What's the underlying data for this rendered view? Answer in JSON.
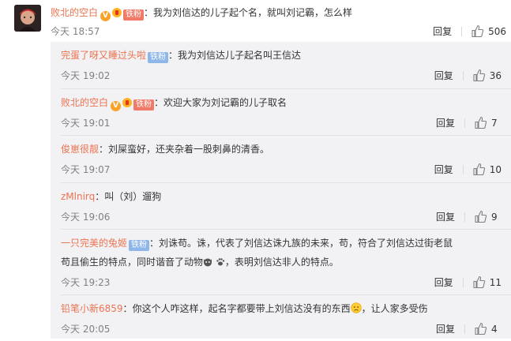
{
  "main": {
    "user": "败北的空白",
    "badge": "铁粉",
    "text": "我为刘信达的儿子起个名，就叫刘记霸，怎么样",
    "time": "今天 18:57",
    "reply_label": "回复",
    "likes": "506"
  },
  "replies": [
    {
      "user": "完蛋了呀又睡过头啦",
      "badge": "铁粉",
      "text": "我为刘信达儿子起名叫王信达",
      "time": "今天 19:02",
      "likes": "36"
    },
    {
      "user": "败北的空白",
      "badge": "铁粉",
      "text": "欢迎大家为刘记霸的儿子取名",
      "time": "今天 19:01",
      "likes": "7"
    },
    {
      "user": "俊崽很靓",
      "text": "刘屎蛮好，还夹杂着一股刺鼻的清香。",
      "time": "今天 19:07",
      "likes": "10"
    },
    {
      "user": "zMlnirq",
      "text": "叫（刘）遛狗",
      "time": "今天 19:06",
      "likes": "9"
    },
    {
      "user": "一只完美的兔姬",
      "badge": "铁粉",
      "text": "刘诛苟。诛，代表了刘信达诛九族的未来，苟，符合了刘信达过街老鼠",
      "text2a": "苟且偷生的特点，同时谐音了动物",
      "text2b": "，表明刘信达非人的特点。",
      "time": "今天 19:23",
      "likes": "11"
    },
    {
      "user": "铅笔小新6859",
      "text": "你这个人咋这样，起名字都要带上刘信达没有的东西",
      "text_tail": "，让人家多受伤",
      "time": "今天 20:05",
      "likes": "4"
    }
  ],
  "reply_label": "回复",
  "colors": {
    "username": "#eb7350",
    "badge_red": "#f07a67",
    "badge_blue": "#8fb6e8",
    "reply_bg": "#f2f2f5"
  }
}
